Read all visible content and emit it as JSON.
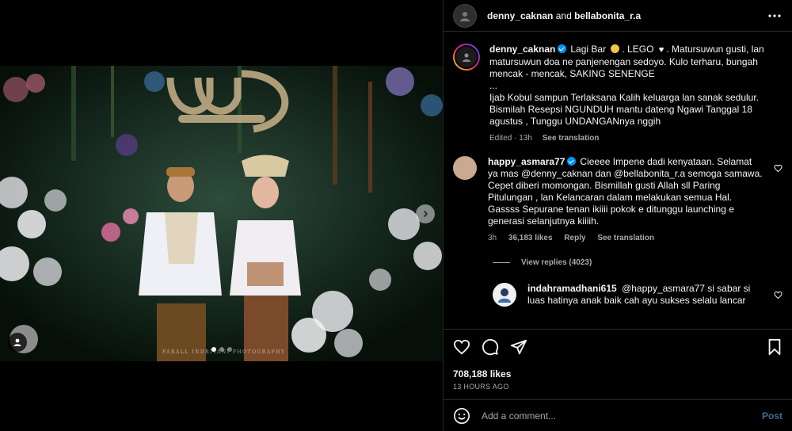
{
  "post": {
    "photo_watermark": "FARALL INDRIYANI PHOTOGRAPHY",
    "carousel": {
      "slide_count": 3,
      "active_index": 0
    }
  },
  "header": {
    "user1": "denny_caknan",
    "conjunction": "and",
    "user2": "bellabonita_r.a"
  },
  "caption": {
    "username": "denny_caknan",
    "text_part1": "Lagi Bar",
    "text_part2": ". LEGO",
    "text_part3": ". Matursuwun gusti, lan matursuwun doa ne panjenengan sedoyo. Kulo terharu, bungah mencak - mencak, SAKING SENENGE",
    "ellipsis": "...",
    "text_part4": "Ijab Kobul sampun Terlaksana Kalih keluarga lan sanak sedulur. Bismilah Resepsi NGUNDUH mantu dateng Ngawi Tanggal 18 agustus , Tunggu UNDANGANnya nggih",
    "edited": "Edited · 13h",
    "see_translation": "See translation"
  },
  "comments": [
    {
      "username": "happy_asmara77",
      "text": "Cieeee Impene dadi kenyataan. Selamat ya mas @denny_caknan dan @bellabonita_r.a semoga samawa. Cepet diberi momongan. Bismillah gusti Allah sll Paring Pitulungan , lan Kelancaran dalam melakukan semua Hal. Gassss Sepurane tenan ikiiii pokok e ditunggu launching e generasi selanjutnya kiiiih.",
      "time": "3h",
      "likes": "36,183 likes",
      "reply": "Reply",
      "see_translation": "See translation",
      "view_replies": "View replies (4023)",
      "avatar_color": "#c9a98f"
    }
  ],
  "reply": {
    "username": "indahramadhani615",
    "text": "@happy_asmara77 si sabar si luas hatinya anak baik cah ayu sukses selalu lancar"
  },
  "actions": {
    "likes": "708,188 likes",
    "timestamp": "13 HOURS AGO"
  },
  "comment_box": {
    "placeholder": "Add a comment...",
    "post_label": "Post"
  },
  "colors": {
    "accent_blue": "#0095f6",
    "post_button": "#3f6b93",
    "muted_text": "#a8a8a8"
  }
}
